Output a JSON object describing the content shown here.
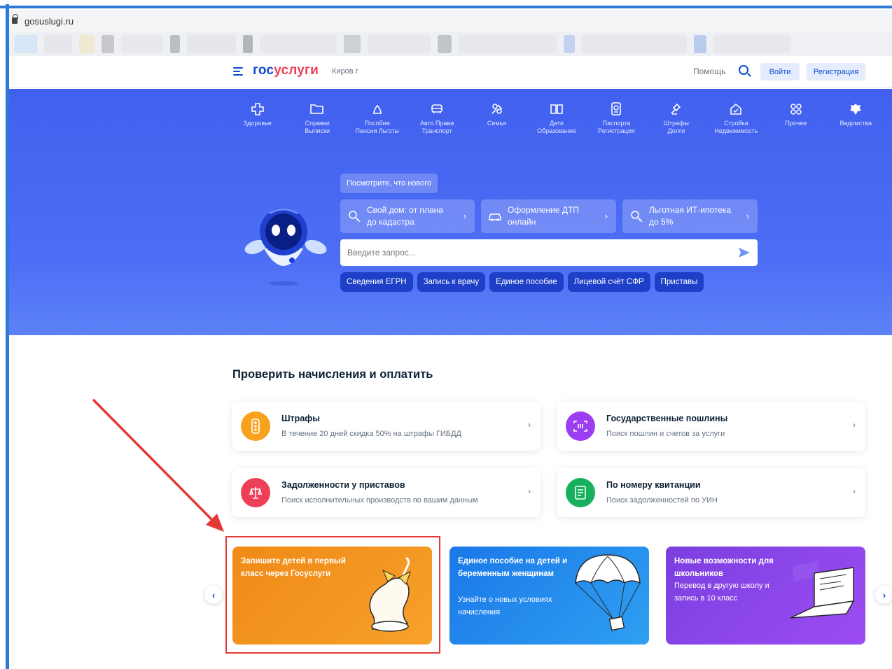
{
  "browser": {
    "url": "gosuslugi.ru"
  },
  "header": {
    "logo_part1": "гос",
    "logo_part2": "услуги",
    "city": "Киров г",
    "help": "Помощь",
    "login": "Войти",
    "register": "Регистрация"
  },
  "categories": [
    {
      "icon": "health-icon",
      "label": "Здоровье"
    },
    {
      "icon": "folder-icon",
      "label": "Справки\nВыписки"
    },
    {
      "icon": "benefits-icon",
      "label": "Пособия\nПенсии Льготы"
    },
    {
      "icon": "car-icon",
      "label": "Авто Права\nТранспорт"
    },
    {
      "icon": "family-icon",
      "label": "Семья"
    },
    {
      "icon": "book-icon",
      "label": "Дети\nОбразование"
    },
    {
      "icon": "passport-icon",
      "label": "Паспорта\nРегистрация"
    },
    {
      "icon": "gavel-icon",
      "label": "Штрафы\nДолги"
    },
    {
      "icon": "house-icon",
      "label": "Стройка\nНедвижимость"
    },
    {
      "icon": "grid-icon",
      "label": "Прочее"
    },
    {
      "icon": "emblem-icon",
      "label": "Ведомства"
    }
  ],
  "hero": {
    "whats_new": "Посмотрите, что нового",
    "promos": [
      {
        "icon": "key-search-icon",
        "text": "Свой дом: от плана до кадастра"
      },
      {
        "icon": "car-outline-icon",
        "text": "Оформление ДТП онлайн"
      },
      {
        "icon": "key-search-icon",
        "text": "Льготная ИТ-ипотека до 5%"
      }
    ],
    "search_placeholder": "Введите запрос...",
    "quick_chips": [
      "Сведения ЕГРН",
      "Запись к врачу",
      "Единое пособие",
      "Лицевой счёт СФР",
      "Приставы"
    ]
  },
  "payments": {
    "title": "Проверить начисления и оплатить",
    "cards": [
      {
        "icon": "traffic-light-icon",
        "color": "#f7a11d",
        "title": "Штрафы",
        "subtitle": "В течение 20 дней скидка 50% на штрафы ГИБДД"
      },
      {
        "icon": "fee-icon",
        "color": "#9b3ef2",
        "title": "Государственные пошлины",
        "subtitle": "Поиск пошлин и счетов за услуги"
      },
      {
        "icon": "scales-icon",
        "color": "#ee3f58",
        "title": "Задолженности у приставов",
        "subtitle": "Поиск исполнительных производств по вашим данным"
      },
      {
        "icon": "receipt-icon",
        "color": "#17b15e",
        "title": "По номеру квитанции",
        "subtitle": "Поиск задолженностей по УИН"
      }
    ]
  },
  "banners": [
    {
      "title": "Запишите детей в первый класс через Госуслуги",
      "subtitle": ""
    },
    {
      "title": "Единое пособие на детей и беременным женщинам",
      "subtitle": "Узнайте о новых условиях начисления"
    },
    {
      "title": "Новые возможности для школьников",
      "subtitle": "Перевод в другую школу и запись в 10 класс"
    }
  ]
}
